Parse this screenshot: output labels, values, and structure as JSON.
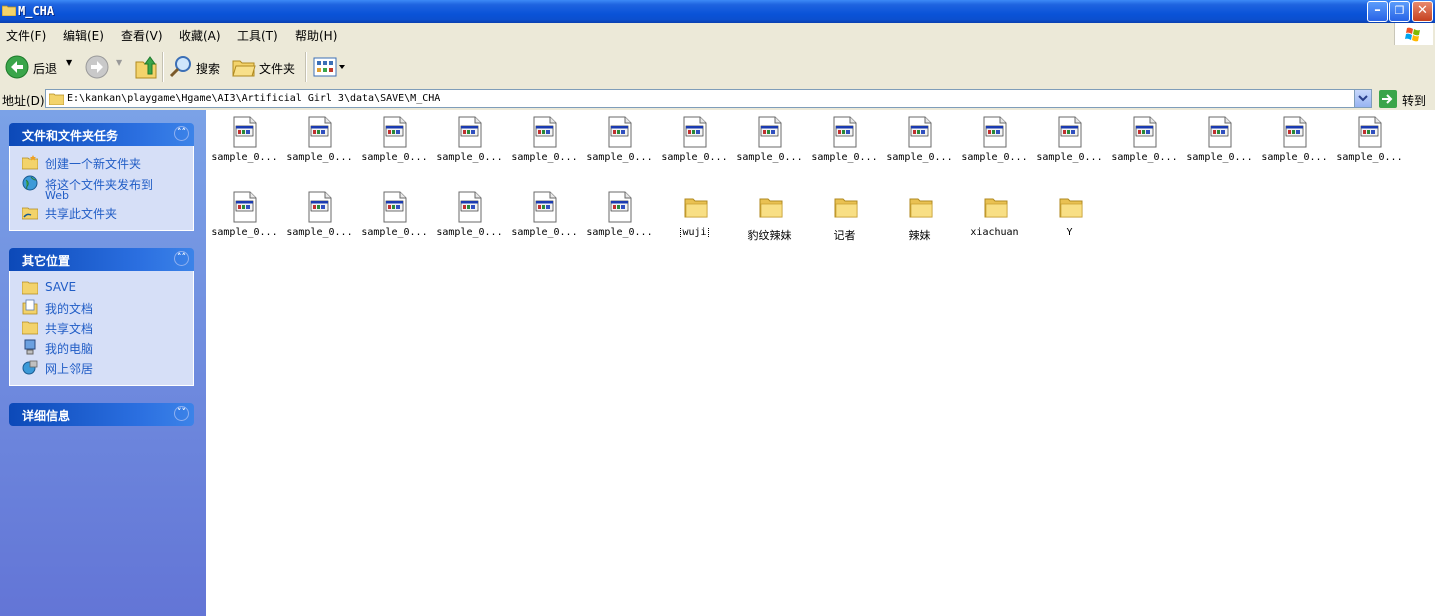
{
  "window": {
    "title": "M_CHA",
    "buttons": [
      "minimize",
      "restore",
      "close"
    ]
  },
  "menu": [
    {
      "label": "文件(F)"
    },
    {
      "label": "编辑(E)"
    },
    {
      "label": "查看(V)"
    },
    {
      "label": "收藏(A)"
    },
    {
      "label": "工具(T)"
    },
    {
      "label": "帮助(H)"
    }
  ],
  "toolbar": {
    "back": "后退",
    "search": "搜索",
    "folders": "文件夹"
  },
  "address": {
    "label": "地址(D)",
    "path": "E:\\kankan\\playgame\\Hgame\\AI3\\Artificial Girl 3\\data\\SAVE\\M_CHA",
    "go": "转到"
  },
  "tasks": {
    "title": "文件和文件夹任务",
    "items": [
      {
        "label": "创建一个新文件夹",
        "icon": "new-folder-icon"
      },
      {
        "label": "将这个文件夹发布到",
        "label2": "Web",
        "icon": "publish-web-icon"
      },
      {
        "label": "共享此文件夹",
        "icon": "share-folder-icon"
      }
    ]
  },
  "places": {
    "title": "其它位置",
    "items": [
      {
        "label": "SAVE",
        "icon": "folder-icon"
      },
      {
        "label": "我的文档",
        "icon": "my-documents-icon"
      },
      {
        "label": "共享文档",
        "icon": "shared-documents-icon"
      },
      {
        "label": "我的电脑",
        "icon": "my-computer-icon"
      },
      {
        "label": "网上邻居",
        "icon": "network-places-icon"
      }
    ]
  },
  "details": {
    "title": "详细信息"
  },
  "files": [
    {
      "name": "sample_0...",
      "type": "file"
    },
    {
      "name": "sample_0...",
      "type": "file"
    },
    {
      "name": "sample_0...",
      "type": "file"
    },
    {
      "name": "sample_0...",
      "type": "file"
    },
    {
      "name": "sample_0...",
      "type": "file"
    },
    {
      "name": "sample_0...",
      "type": "file"
    },
    {
      "name": "sample_0...",
      "type": "file"
    },
    {
      "name": "sample_0...",
      "type": "file"
    },
    {
      "name": "sample_0...",
      "type": "file"
    },
    {
      "name": "sample_0...",
      "type": "file"
    },
    {
      "name": "sample_0...",
      "type": "file"
    },
    {
      "name": "sample_0...",
      "type": "file"
    },
    {
      "name": "sample_0...",
      "type": "file"
    },
    {
      "name": "sample_0...",
      "type": "file"
    },
    {
      "name": "sample_0...",
      "type": "file"
    },
    {
      "name": "sample_0...",
      "type": "file"
    },
    {
      "name": "sample_0...",
      "type": "file"
    },
    {
      "name": "sample_0...",
      "type": "file"
    },
    {
      "name": "sample_0...",
      "type": "file"
    },
    {
      "name": "sample_0...",
      "type": "file"
    },
    {
      "name": "sample_0...",
      "type": "file"
    },
    {
      "name": "sample_0...",
      "type": "file"
    },
    {
      "name": "wuji",
      "type": "folder",
      "focused": true
    },
    {
      "name": "豹纹辣妹",
      "type": "folder"
    },
    {
      "name": "记者",
      "type": "folder"
    },
    {
      "name": "辣妹",
      "type": "folder"
    },
    {
      "name": "xiachuan",
      "type": "folder"
    },
    {
      "name": "Y",
      "type": "folder"
    }
  ]
}
